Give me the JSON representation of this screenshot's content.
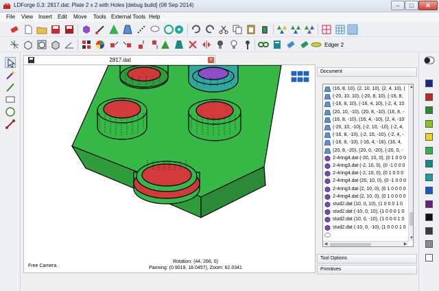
{
  "window": {
    "title": "LDForge 0.3: 2817.dat: Plate  2 x  2 with Holes [debug build] (08 Sep 2014)",
    "controls": [
      "–",
      "□",
      "✕"
    ]
  },
  "menu": [
    "File",
    "View",
    "Insert",
    "Edit",
    "Move",
    "Tools",
    "External Tools",
    "Help"
  ],
  "toolbar": {
    "edger_label": "Edger 2"
  },
  "tab": {
    "label": "2817.dat",
    "close_glyph": "✕"
  },
  "viewport": {
    "camera_label": "Free Camera",
    "rotation_text": "Rotation: (44, 266, 0)",
    "panning_text": "Panning: (0.9019, 18.0457), Zoom: 62.0341"
  },
  "panels": {
    "document_label": "Document",
    "tool_options_label": "Tool Options",
    "primitives_label": "Primitives"
  },
  "document_rows": [
    {
      "icon": "quad",
      "text": "(16, 8, 10), (2, 10, 10), (2, 4, 10), ("
    },
    {
      "icon": "quad",
      "text": "(-20, 10, 10), (-20, 8, 10), (-16, 8,"
    },
    {
      "icon": "quad",
      "text": "(-16, 8, 10), (-16, 4, 10), (-2, 4, 10"
    },
    {
      "icon": "quad",
      "text": "(20, 10, -10), (20, 8, -10), (16, 8, -"
    },
    {
      "icon": "quad",
      "text": "(16, 8, -10), (16, 4, -10), (2, 4, -10"
    },
    {
      "icon": "quad",
      "text": "(-20, 10, -10), (-2, 10, -10), (-2, 4,"
    },
    {
      "icon": "quad",
      "text": "(-16, 8, -10), (-2, 10, -10), (-2, 4, -"
    },
    {
      "icon": "quad",
      "text": "(-16, 8, -10), (-16, 4, -16), (16, 4,"
    },
    {
      "icon": "quad",
      "text": "(20, 8, -20), (20, 0, -20), (-20, 0, -"
    },
    {
      "icon": "subfile",
      "text": "2-4ring4.dat (-20, 10, 0), (0 1 0 0 0"
    },
    {
      "icon": "subfile",
      "text": "2-4ring3.dat (-2, 10, 0), (0 -1 0 0 0"
    },
    {
      "icon": "subfile",
      "text": "2-4ring4.dat (-2, 10, 0), (0 1 0 0 0"
    },
    {
      "icon": "subfile",
      "text": "2-4ring4.dat (20, 10, 0), (0 -1 0 0 0"
    },
    {
      "icon": "subfile",
      "text": "2-4ring3.dat (2, 10, 0), (0 1 0 0 0 0"
    },
    {
      "icon": "subfile",
      "text": "2-4ring4.dat (2, 10, 0), (0 1 0 0 0 0"
    },
    {
      "icon": "subfile",
      "text": "stud2.dat (10, 0, 10), (1 0 0 0 1 0"
    },
    {
      "icon": "subfile",
      "text": "stud2.dat (-10, 0, 10), (1 0 0 0 1 0"
    },
    {
      "icon": "subfile",
      "text": "stud2.dat (10, 0, -10), (1 0 0 0 1 0"
    },
    {
      "icon": "subfile",
      "text": "stud2.dat (-10, 0, -10), (1 0 0 0 1 0"
    },
    {
      "icon": "comment",
      "text": ""
    }
  ],
  "colors": {
    "part_green": "#36b846",
    "stud_red": "#d23a3a",
    "teal": "#2fa8a0",
    "purple": "#8a4fc8",
    "quad_blue": "#5a8fd8",
    "subfile_purple": "#7a48b8"
  },
  "palette": [
    "#1b2a8a",
    "#c4281b",
    "#2c8a2c",
    "#8ac21a",
    "#f2d21a",
    "#37b14a",
    "#0d8a8a",
    "#1e9c9c",
    "#1a56c6",
    "#6a1a8a",
    "#111111",
    "#3a3a3a",
    "#8a8a8a",
    "#ffffff"
  ]
}
